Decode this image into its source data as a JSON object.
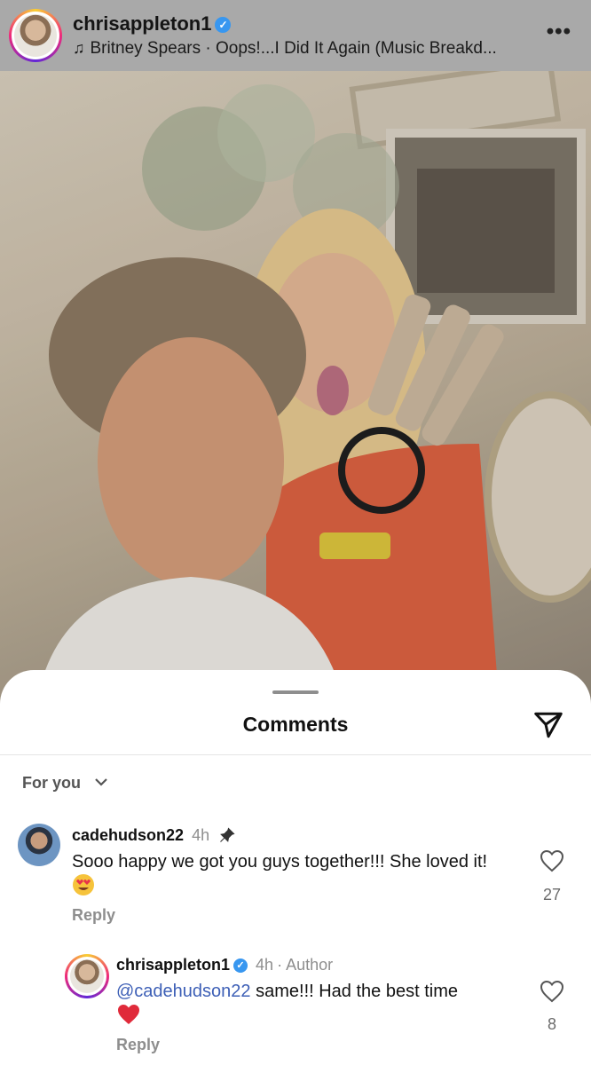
{
  "post": {
    "username": "chrisappleton1",
    "verified": true,
    "music": "Britney Spears · Oops!...I Did It Again (Music Breakd...",
    "more_icon": "more-horizontal-icon"
  },
  "comments_sheet": {
    "title": "Comments",
    "share_icon": "paper-plane-icon",
    "sort_label": "For you",
    "comments": [
      {
        "username": "cadehudson22",
        "time": "4h",
        "pinned": true,
        "text": "Sooo happy we got you guys together!!! She loved it!",
        "emoji": "heart-eyes-emoji",
        "reply_label": "Reply",
        "likes": "27"
      },
      {
        "username": "chrisappleton1",
        "verified": true,
        "time": "4h",
        "author_label": "Author",
        "mention": "@cadehudson22",
        "text": " same!!! Had the best time",
        "emoji": "red-heart-emoji",
        "reply_label": "Reply",
        "likes": "8"
      }
    ]
  },
  "colors": {
    "header_bg": "#a9a9a9",
    "verified_blue": "#3897f0",
    "mention_blue": "#3d5fb6",
    "muted_gray": "#8e8e8e"
  }
}
